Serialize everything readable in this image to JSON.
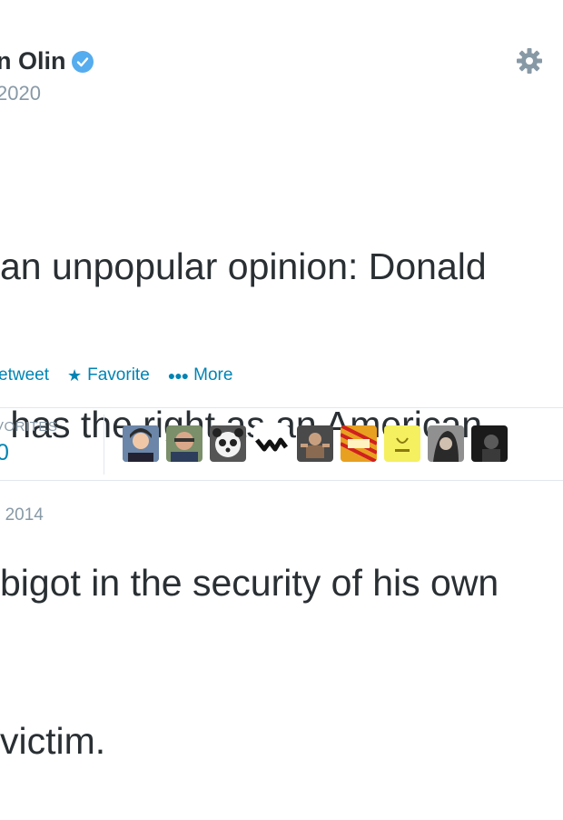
{
  "user": {
    "name_partial": "n Olin",
    "handle_partial": "2020",
    "verified_icon": "verified-check-icon"
  },
  "tweet": {
    "lines": [
      "an unpopular opinion: Donald",
      " has the right as an American",
      "bigot in the security of his own",
      "victim."
    ]
  },
  "actions": {
    "retweet": "etweet",
    "favorite": "Favorite",
    "more": "More"
  },
  "stats": {
    "label": "VORITES",
    "value": "0"
  },
  "favoriters": [
    {
      "name": "avatar-1"
    },
    {
      "name": "avatar-2"
    },
    {
      "name": "avatar-3"
    },
    {
      "name": "avatar-4"
    },
    {
      "name": "avatar-5"
    },
    {
      "name": "avatar-6"
    },
    {
      "name": "avatar-7"
    },
    {
      "name": "avatar-8"
    },
    {
      "name": "avatar-9"
    }
  ],
  "timestamp": "r 2014",
  "colors": {
    "link": "#0084b4",
    "muted": "#8899a6",
    "text": "#292f33",
    "verified": "#55acee"
  }
}
